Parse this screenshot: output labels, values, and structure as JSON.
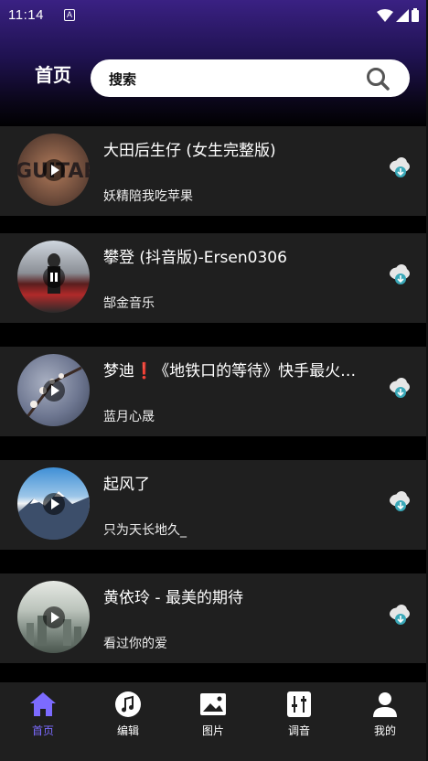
{
  "status_bar": {
    "time": "11:14",
    "notification_glyph": "A"
  },
  "header": {
    "title": "首页",
    "search_placeholder": "搜索"
  },
  "songs": [
    {
      "title": "大田后生仔 (女生完整版)",
      "artist": "妖精陪我吃苹果",
      "state": "play"
    },
    {
      "title": "攀登 (抖音版)-Ersen0306",
      "artist": "郜金音乐",
      "state": "pause"
    },
    {
      "title": "梦迪❗《地铁口的等待》快手最火的女声版",
      "artist": "蓝月心晟",
      "state": "play"
    },
    {
      "title": "起风了",
      "artist": "只为天长地久_",
      "state": "play"
    },
    {
      "title": "黄依玲 - 最美的期待",
      "artist": "看过你的爱",
      "state": "play"
    }
  ],
  "nav": [
    {
      "label": "首页",
      "icon": "home-icon",
      "active": true
    },
    {
      "label": "编辑",
      "icon": "music-note-icon",
      "active": false
    },
    {
      "label": "图片",
      "icon": "image-icon",
      "active": false
    },
    {
      "label": "调音",
      "icon": "equalizer-icon",
      "active": false
    },
    {
      "label": "我的",
      "icon": "person-icon",
      "active": false
    }
  ],
  "colors": {
    "accent": "#7c6bff",
    "header_top": "#3a2183",
    "card": "#1f1f1f",
    "download": "#3aa8b8"
  }
}
